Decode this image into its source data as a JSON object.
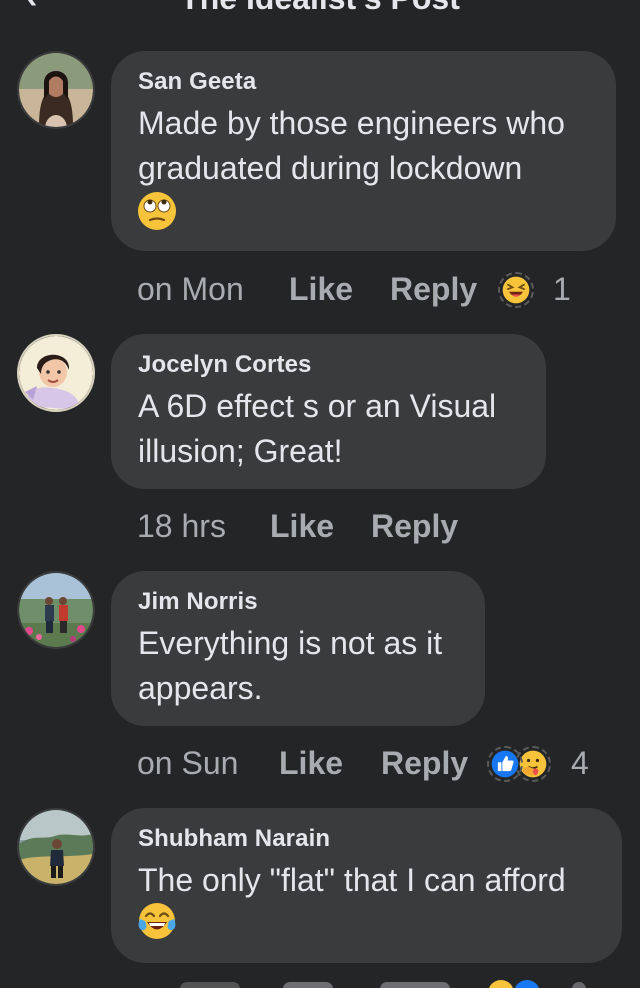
{
  "header": {
    "title": "The Idealist's Post",
    "back_icon": "chevron-left-icon"
  },
  "comments": [
    {
      "author": "San Geeta",
      "text": "Made by those engineers who graduated during lockdown",
      "emoji": "face-with-rolling-eyes",
      "time": "on Mon",
      "like": "Like",
      "reply": "Reply",
      "reactions": [
        "laughing-squinting-face"
      ],
      "reaction_count": "1"
    },
    {
      "author": "Jocelyn Cortes",
      "text": "A 6D effect s or an Visual illusion; Great!",
      "time": "18 hrs",
      "like": "Like",
      "reply": "Reply"
    },
    {
      "author": "Jim Norris",
      "text": "Everything is not as it appears.",
      "time": "on Sun",
      "like": "Like",
      "reply": "Reply",
      "reactions": [
        "like-thumbs-up",
        "care-hug-face"
      ],
      "reaction_count": "4"
    },
    {
      "author": "Shubham Narain",
      "text": "The only \"flat\" that I can afford",
      "emoji": "face-with-tears-of-joy"
    }
  ],
  "colors": {
    "background": "#242527",
    "bubble": "#3a3b3c",
    "text": "#e4e6eb",
    "secondary_text": "#a8abaf",
    "like_blue": "#1877f2"
  }
}
